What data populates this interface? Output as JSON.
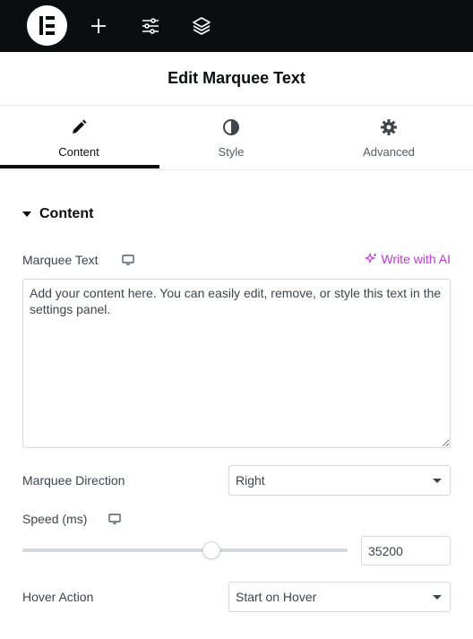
{
  "topbar": {
    "icons": [
      "elementor-logo-icon",
      "add-icon",
      "site-settings-icon",
      "structure-layers-icon"
    ]
  },
  "panel": {
    "title": "Edit Marquee Text"
  },
  "tabs": [
    {
      "label": "Content",
      "icon": "pencil-icon",
      "active": true
    },
    {
      "label": "Style",
      "icon": "half-circle-icon",
      "active": false
    },
    {
      "label": "Advanced",
      "icon": "gear-icon",
      "active": false
    }
  ],
  "section": {
    "title": "Content",
    "expanded": true
  },
  "controls": {
    "marquee_text": {
      "label": "Marquee Text",
      "ai_label": "Write with AI",
      "value": "Add your content here. You can easily edit, remove, or style this text in the settings panel."
    },
    "direction": {
      "label": "Marquee Direction",
      "value": "Right"
    },
    "speed": {
      "label": "Speed (ms)",
      "value": "35200",
      "slider_fraction": 0.58
    },
    "hover": {
      "label": "Hover Action",
      "value": "Start on Hover"
    }
  },
  "colors": {
    "accent_ai": "#c036d6",
    "topbar": "#0c0d0e"
  }
}
